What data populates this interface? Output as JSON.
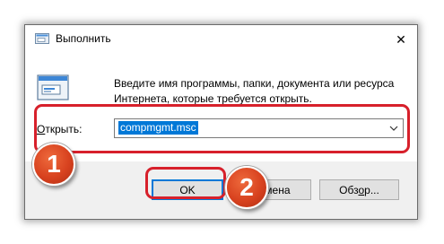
{
  "window": {
    "title": "Выполнить",
    "close_glyph": "✕"
  },
  "content": {
    "description_line1": "Введите имя программы, папки, документа или ресурса",
    "description_line2": "Интернета, которые требуется открыть."
  },
  "open_field": {
    "label_prefix": "",
    "label_access_key": "О",
    "label_rest": "ткрыть:",
    "value": "compmgmt.msc"
  },
  "buttons": {
    "ok": "OK",
    "cancel": "Отмена",
    "browse_prefix": "Обз",
    "browse_access_key": "о",
    "browse_rest": "р..."
  },
  "annotations": {
    "step1": "1",
    "step2": "2",
    "highlight_color": "#d7202b",
    "badge_color": "#d8421f"
  },
  "colors": {
    "selection": "#0078d7",
    "default_button_border": "#0078d7",
    "footer_bg": "#f0f0f0"
  },
  "icons": {
    "title": "run-app-icon",
    "main": "run-app-icon",
    "close": "close-icon",
    "dropdown": "chevron-down-icon"
  }
}
